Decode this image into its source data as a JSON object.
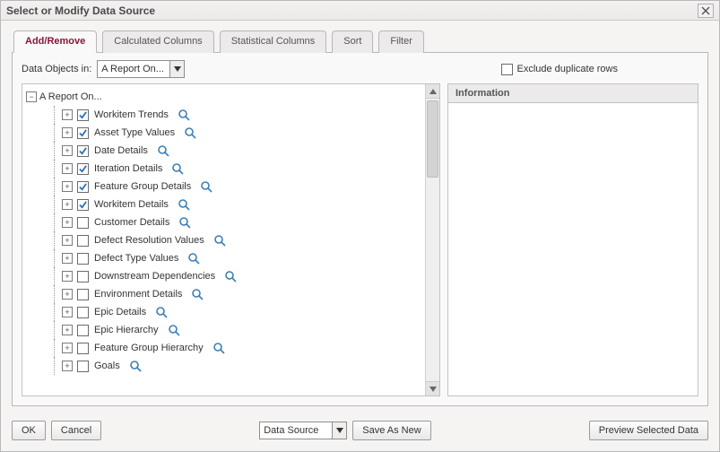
{
  "window": {
    "title": "Select or Modify Data Source"
  },
  "tabs": {
    "add_remove": "Add/Remove",
    "calculated": "Calculated Columns",
    "statistical": "Statistical Columns",
    "sort": "Sort",
    "filter": "Filter"
  },
  "toprow": {
    "data_objects_label": "Data Objects in:",
    "data_objects_value": "A Report On...",
    "exclude_dup_label": "Exclude duplicate rows"
  },
  "tree": {
    "root_label": "A Report On...",
    "items": [
      {
        "label": "Workitem Trends",
        "checked": true
      },
      {
        "label": "Asset Type Values",
        "checked": true
      },
      {
        "label": "Date Details",
        "checked": true
      },
      {
        "label": "Iteration Details",
        "checked": true
      },
      {
        "label": "Feature Group Details",
        "checked": true
      },
      {
        "label": "Workitem Details",
        "checked": true
      },
      {
        "label": "Customer Details",
        "checked": false
      },
      {
        "label": "Defect Resolution Values",
        "checked": false
      },
      {
        "label": "Defect Type Values",
        "checked": false
      },
      {
        "label": "Downstream Dependencies",
        "checked": false
      },
      {
        "label": "Environment Details",
        "checked": false
      },
      {
        "label": "Epic Details",
        "checked": false
      },
      {
        "label": "Epic Hierarchy",
        "checked": false
      },
      {
        "label": "Feature Group Hierarchy",
        "checked": false
      },
      {
        "label": "Goals",
        "checked": false
      }
    ]
  },
  "info": {
    "header": "Information"
  },
  "footer": {
    "ok": "OK",
    "cancel": "Cancel",
    "data_source": "Data Source",
    "save_as_new": "Save As New",
    "preview": "Preview Selected Data"
  }
}
